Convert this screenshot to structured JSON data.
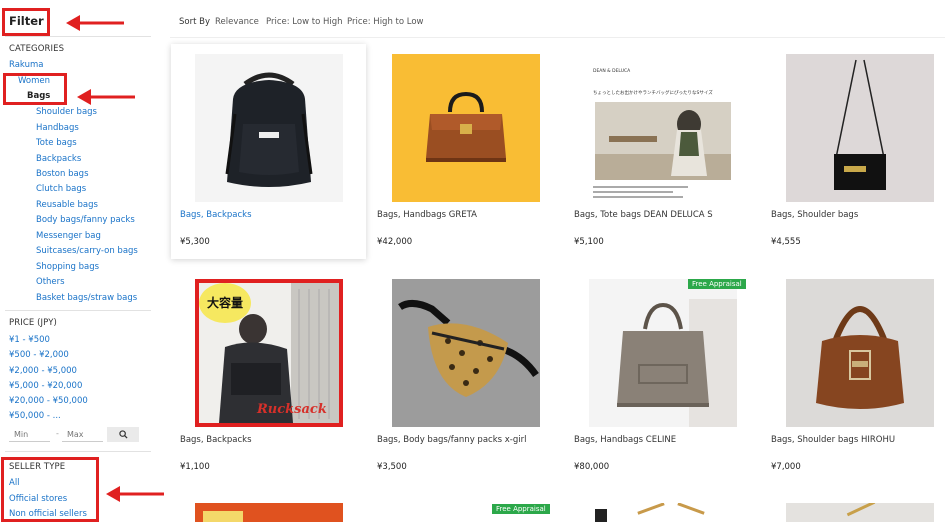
{
  "sidebar": {
    "filter_title": "Filter",
    "categories": {
      "title": "CATEGORIES",
      "root": "Rakuma",
      "level1": "Women",
      "level2": "Bags",
      "subcats": [
        "Shoulder bags",
        "Handbags",
        "Tote bags",
        "Backpacks",
        "Boston bags",
        "Clutch bags",
        "Reusable bags",
        "Body bags/fanny packs",
        "Messenger bag",
        "Suitcases/carry-on bags",
        "Shopping bags",
        "Others",
        "Basket bags/straw bags"
      ]
    },
    "price": {
      "title": "PRICE (JPY)",
      "ranges": [
        "¥1 - ¥500",
        "¥500 - ¥2,000",
        "¥2,000 - ¥5,000",
        "¥5,000 - ¥20,000",
        "¥20,000 - ¥50,000",
        "¥50,000 - ..."
      ],
      "min_placeholder": "Min",
      "max_placeholder": "Max",
      "separator": "-"
    },
    "seller_type": {
      "title": "SELLER TYPE",
      "options": [
        "All",
        "Official stores",
        "Non official sellers"
      ]
    }
  },
  "sort": {
    "label": "Sort By",
    "options": [
      "Relevance",
      "Price: Low to High",
      "Price: High to Low"
    ]
  },
  "products": [
    {
      "title": "Bags, Backpacks",
      "price": "¥5,300",
      "highlighted": true
    },
    {
      "title": "Bags, Handbags GRETA",
      "price": "¥42,000"
    },
    {
      "title": "Bags, Tote bags DEAN DELUCA S",
      "price": "¥5,100"
    },
    {
      "title": "Bags, Shoulder bags",
      "price": "¥4,555"
    },
    {
      "title": "Bags, Backpacks",
      "price": "¥1,100"
    },
    {
      "title": "Bags, Body bags/fanny packs x-girl",
      "price": "¥3,500"
    },
    {
      "title": "Bags, Handbags CELINE",
      "price": "¥80,000",
      "badge": "Free Appraisal"
    },
    {
      "title": "Bags, Shoulder bags HIROHU",
      "price": "¥7,000"
    }
  ],
  "image_text": {
    "p3_brand": "DEAN & DELUCA",
    "p3_headline": "ちょっとしたお出かけやランチバッグにぴったりなSサイズ",
    "p5_sticker": "大容量",
    "p5_caption": "Rucksack",
    "row3_badge": "Free Appraisal"
  },
  "colors": {
    "link": "#1a73c8",
    "annotation_red": "#e02020",
    "badge_green": "#2ca84a"
  }
}
